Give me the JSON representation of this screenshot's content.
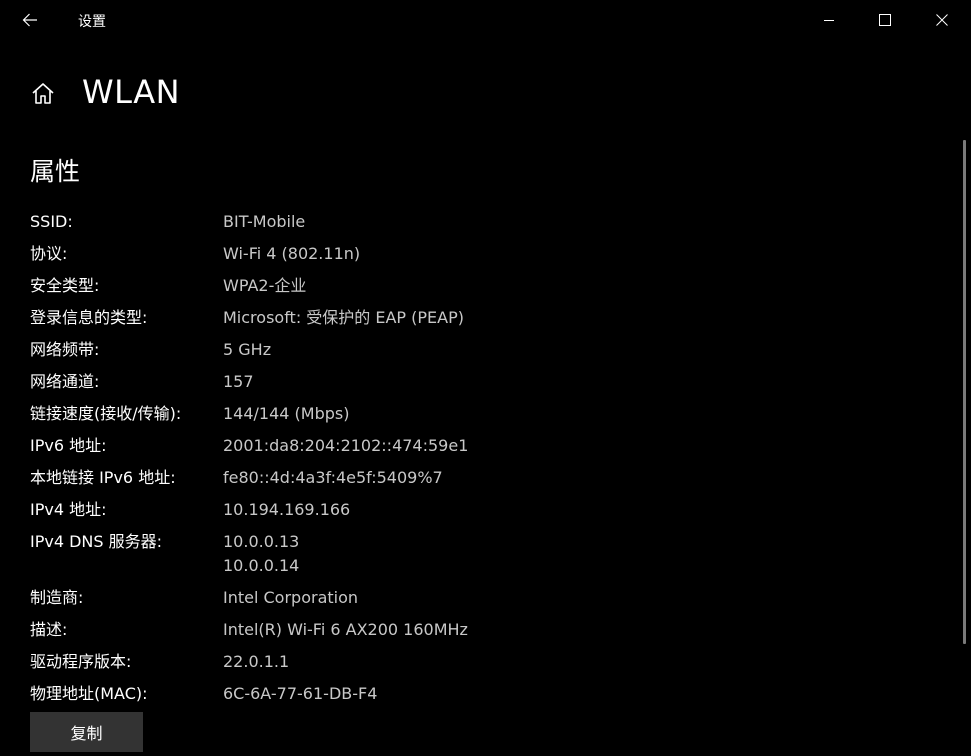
{
  "window": {
    "title": "设置"
  },
  "header": {
    "title": "WLAN"
  },
  "section": {
    "title": "属性"
  },
  "properties": [
    {
      "label": "SSID:",
      "values": [
        "BIT-Mobile"
      ]
    },
    {
      "label": "协议:",
      "values": [
        "Wi-Fi 4 (802.11n)"
      ]
    },
    {
      "label": "安全类型:",
      "values": [
        "WPA2-企业"
      ]
    },
    {
      "label": "登录信息的类型:",
      "values": [
        "Microsoft: 受保护的 EAP (PEAP)"
      ]
    },
    {
      "label": "网络频带:",
      "values": [
        "5 GHz"
      ]
    },
    {
      "label": "网络通道:",
      "values": [
        "157"
      ]
    },
    {
      "label": "链接速度(接收/传输):",
      "values": [
        "144/144 (Mbps)"
      ]
    },
    {
      "label": "IPv6 地址:",
      "values": [
        "2001:da8:204:2102::474:59e1"
      ]
    },
    {
      "label": "本地链接 IPv6 地址:",
      "values": [
        "fe80::4d:4a3f:4e5f:5409%7"
      ]
    },
    {
      "label": "IPv4 地址:",
      "values": [
        "10.194.169.166"
      ]
    },
    {
      "label": "IPv4 DNS 服务器:",
      "values": [
        "10.0.0.13",
        "10.0.0.14"
      ]
    },
    {
      "label": "制造商:",
      "values": [
        "Intel Corporation"
      ]
    },
    {
      "label": "描述:",
      "values": [
        "Intel(R) Wi-Fi 6 AX200 160MHz"
      ]
    },
    {
      "label": "驱动程序版本:",
      "values": [
        "22.0.1.1"
      ]
    },
    {
      "label": "物理地址(MAC):",
      "values": [
        "6C-6A-77-61-DB-F4"
      ]
    }
  ],
  "buttons": {
    "copy_label": "复制"
  },
  "icons": {
    "back": "back-arrow-icon",
    "home": "home-icon",
    "minimize": "minimize-icon",
    "maximize": "maximize-icon",
    "close": "close-icon"
  },
  "colors": {
    "background": "#000000",
    "label": "#ffffff",
    "value": "#c8c8c8",
    "button": "#333333"
  }
}
